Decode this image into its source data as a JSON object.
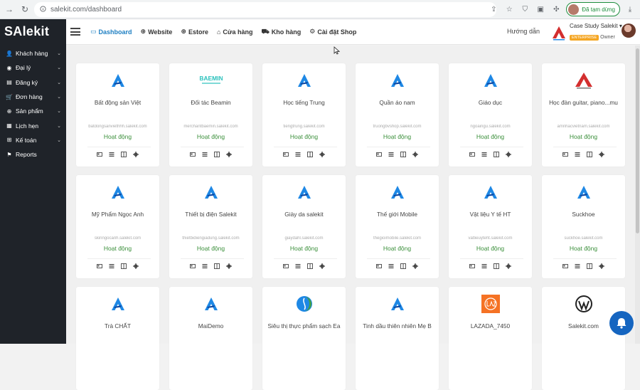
{
  "browser": {
    "url": "salekit.com/dashboard",
    "profile_label": "Đã tạm dừng",
    "accent": "#1e8e3e"
  },
  "sidebar": {
    "logo": "SAlekit",
    "items": [
      {
        "label": "Khách hàng",
        "icon": "user-icon",
        "expandable": true
      },
      {
        "label": "Đại lý",
        "icon": "user-circle-icon",
        "expandable": true
      },
      {
        "label": "Đăng ký",
        "icon": "id-card-icon",
        "expandable": true
      },
      {
        "label": "Đơn hàng",
        "icon": "cart-icon",
        "expandable": true
      },
      {
        "label": "Sản phẩm",
        "icon": "globe-icon",
        "expandable": true
      },
      {
        "label": "Lịch hẹn",
        "icon": "calendar-icon",
        "expandable": true
      },
      {
        "label": "Kế toán",
        "icon": "sitemap-icon",
        "expandable": true
      },
      {
        "label": "Reports",
        "icon": "flag-icon",
        "expandable": false
      }
    ]
  },
  "topbar": {
    "tabs": [
      {
        "label": "Dashboard",
        "icon": "monitor-icon",
        "active": true
      },
      {
        "label": "Website",
        "icon": "globe-icon",
        "active": false
      },
      {
        "label": "Estore",
        "icon": "globe-icon",
        "active": false
      },
      {
        "label": "Cửa hàng",
        "icon": "store-icon",
        "active": false
      },
      {
        "label": "Kho hàng",
        "icon": "truck-icon",
        "active": false
      },
      {
        "label": "Cài đặt Shop",
        "icon": "gear-icon",
        "active": false
      }
    ],
    "guide": "Hướng dẫn",
    "company": {
      "name": "Case Study Salekit",
      "badge": "ENTERPRISE",
      "role": "Owner"
    }
  },
  "shops": [
    {
      "name": "Bất động sản Việt",
      "domain": "batdongsanviethhh.salekit.com",
      "status": "Hoạt động",
      "logo": "salekit-a-logo"
    },
    {
      "name": "Đối tác Beamin",
      "domain": "merchantbaemin.salekit.com",
      "status": "Hoạt động",
      "logo": "baemin-logo"
    },
    {
      "name": "Học tiếng Trung",
      "domain": "tiengtrung.salekit.com",
      "status": "Hoạt động",
      "logo": "salekit-a-logo"
    },
    {
      "name": "Quần áo nam",
      "domain": "truongbvshop.salekit.com",
      "status": "Hoạt động",
      "logo": "salekit-a-logo"
    },
    {
      "name": "Giáo dục",
      "domain": "ngoaingu.salekit.com",
      "status": "Hoạt động",
      "logo": "salekit-a-logo"
    },
    {
      "name": "Học đàn guitar, piano...mu",
      "domain": "amnhacvietnam.salekit.com",
      "status": "Hoạt động",
      "logo": "music-logo"
    },
    {
      "name": "Mỹ Phẩm Ngọc Anh",
      "domain": "skinngocanh.salekit.com",
      "status": "Hoạt động",
      "logo": "salekit-a-logo"
    },
    {
      "name": "Thiết bị điện Salekit",
      "domain": "thietbidiengiadung.salekit.com",
      "status": "Hoạt động",
      "logo": "salekit-a-logo"
    },
    {
      "name": "Giày da salekit",
      "domain": "giaydahl.salekit.com",
      "status": "Hoạt động",
      "logo": "salekit-a-logo"
    },
    {
      "name": "Thế giới Mobile",
      "domain": "thegioimobile.salekit.com",
      "status": "Hoạt động",
      "logo": "salekit-a-logo"
    },
    {
      "name": "Vật liệu Y tế HT",
      "domain": "vatlieuyteht.salekit.com",
      "status": "Hoạt động",
      "logo": "salekit-a-logo"
    },
    {
      "name": "Suckhoe",
      "domain": "suckhoe.salekit.com",
      "status": "Hoạt động",
      "logo": "salekit-a-logo"
    },
    {
      "name": "Trà CHẤT",
      "domain": "",
      "status": "",
      "logo": "salekit-a-logo"
    },
    {
      "name": "MaiDemo",
      "domain": "",
      "status": "",
      "logo": "salekit-a-logo"
    },
    {
      "name": "Siêu thị thực phẩm sạch Ea",
      "domain": "",
      "status": "",
      "logo": "leaf-logo"
    },
    {
      "name": "Tinh dầu thiên nhiên Mẹ B",
      "domain": "",
      "status": "",
      "logo": "salekit-a-logo"
    },
    {
      "name": "LAZADA_7450",
      "domain": "",
      "status": "",
      "logo": "lazada-logo"
    },
    {
      "name": "Salekit.com",
      "domain": "",
      "status": "",
      "logo": "wordpress-logo"
    }
  ],
  "colors": {
    "sidebar_bg": "#1f2329",
    "active_tab": "#1e7fc2",
    "status_green": "#3a8f3a",
    "brand_blue": "#1e88e5",
    "brand_red": "#d32f2f"
  }
}
